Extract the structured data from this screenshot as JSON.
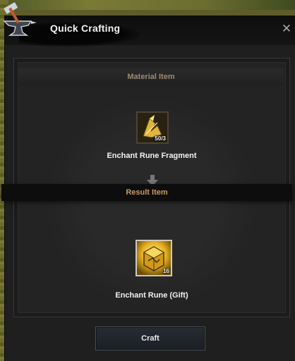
{
  "window": {
    "title": "Quick Crafting",
    "close_label": "✕"
  },
  "material": {
    "header": "Material Item",
    "item_name": "Enchant Rune Fragment",
    "count": "50/3"
  },
  "result": {
    "header": "Result Item",
    "item_name": "Enchant Rune (Gift)",
    "count": "16"
  },
  "actions": {
    "craft_label": "Craft"
  },
  "colors": {
    "material_header": "#9b8a72",
    "result_header": "#c99a66",
    "rune_gold": "#e0b53a"
  },
  "icons": {
    "window_icon": "anvil-hammer-icon",
    "arrow": "arrow-down-icon",
    "fragment": "rune-fragment-icon",
    "rune": "rune-gift-icon"
  }
}
